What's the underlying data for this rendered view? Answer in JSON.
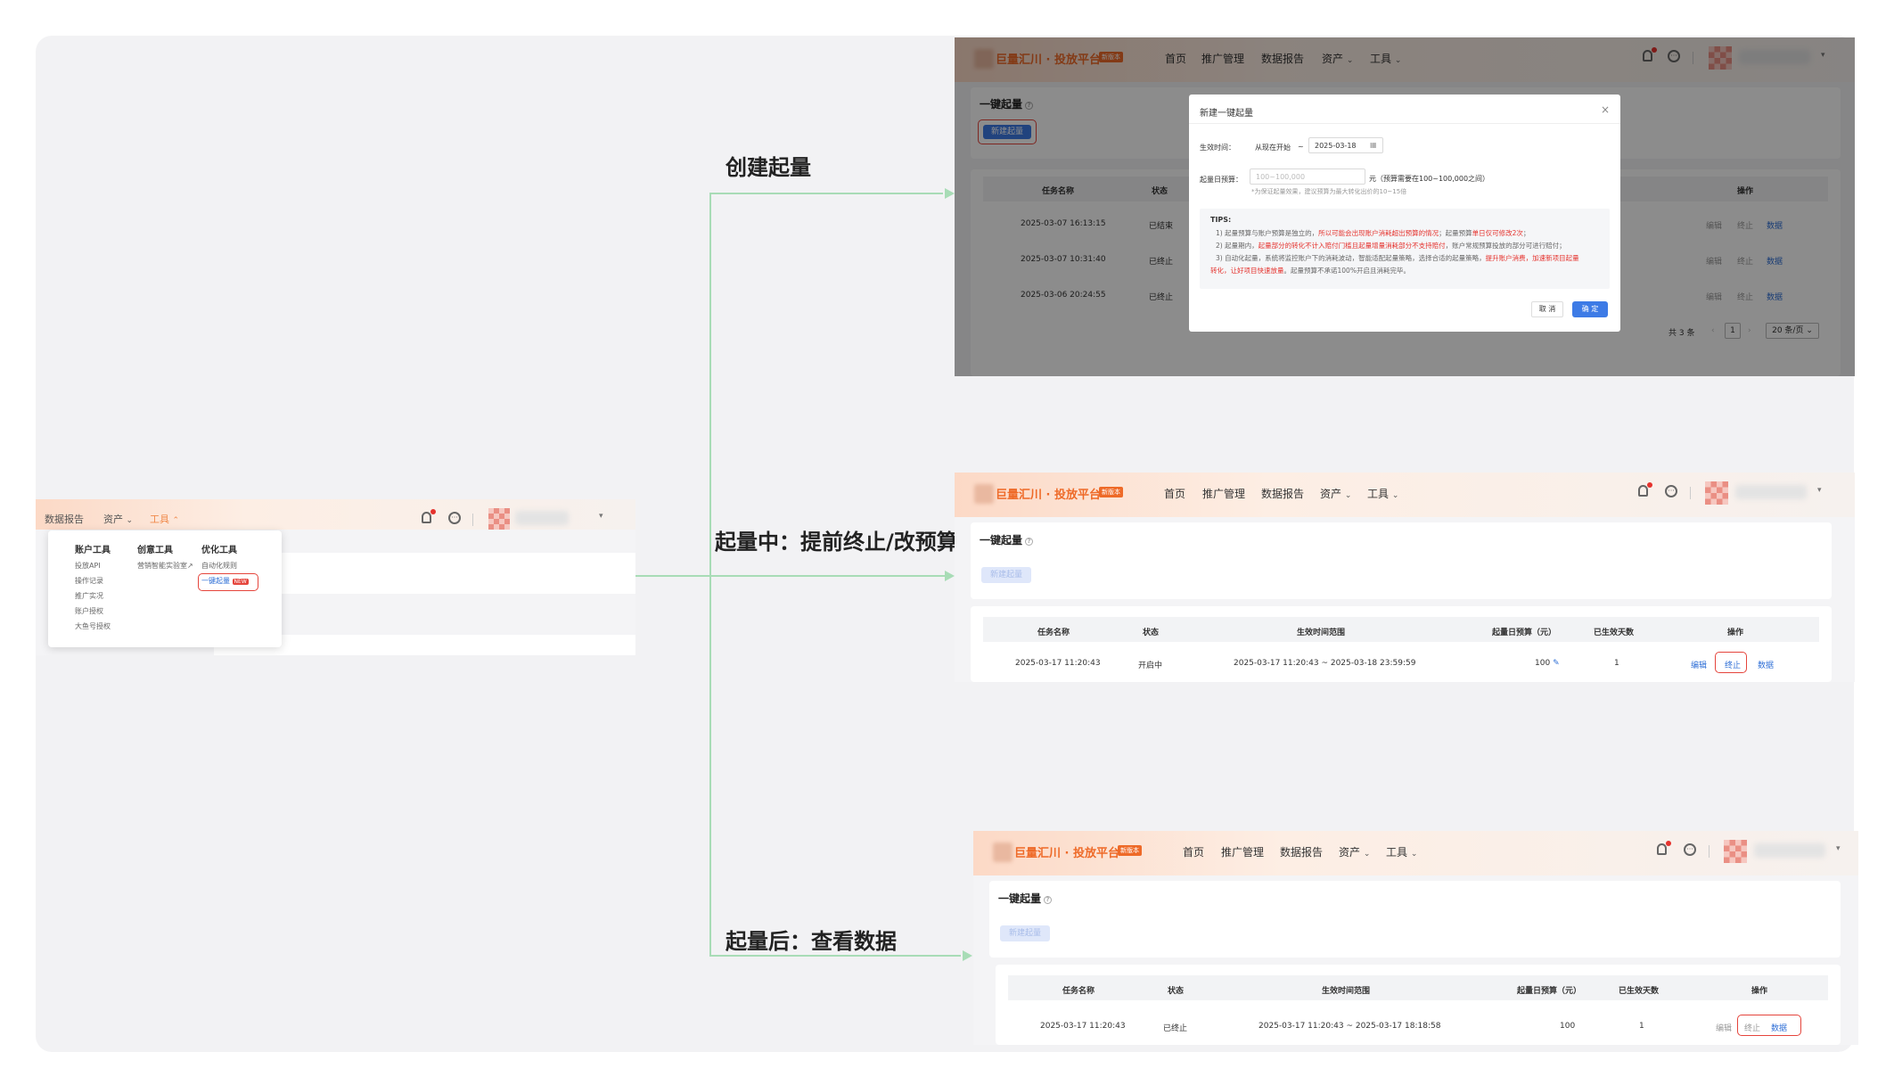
{
  "steps": {
    "create": "创建起量",
    "during": "起量中：提前终止/改预算",
    "after": "起量后：查看数据"
  },
  "header": {
    "brand": "巨量汇川 · 投放平台",
    "brand_badge": "新版本",
    "nav": [
      "首页",
      "推广管理",
      "数据报告",
      "资产",
      "工具"
    ]
  },
  "menu_panel": {
    "nav": [
      "数据报告",
      "资产",
      "工具"
    ],
    "columns": [
      {
        "title": "账户工具",
        "items": [
          "投放API",
          "操作记录",
          "推广实况",
          "账户授权",
          "大鱼号授权"
        ]
      },
      {
        "title": "创意工具",
        "items": [
          "营销智能实验室"
        ]
      },
      {
        "title": "优化工具",
        "items": [
          "自动化规则",
          "一键起量"
        ]
      }
    ],
    "new_badge": "NEW"
  },
  "page": {
    "title": "一键起量",
    "new_button": "新建起量"
  },
  "table": {
    "headers": [
      "任务名称",
      "状态",
      "生效时间范围",
      "起量日预算（元）",
      "已生效天数",
      "操作"
    ],
    "actions": [
      "编辑",
      "终止",
      "数据"
    ]
  },
  "panel_create": {
    "rows": [
      {
        "name": "2025-03-07 16:13:15",
        "status": "已结束"
      },
      {
        "name": "2025-03-07 10:31:40",
        "status": "已终止"
      },
      {
        "name": "2025-03-06 20:24:55",
        "status": "已终止"
      }
    ],
    "pagination": {
      "total": "共 3 条",
      "page": "1",
      "page_size": "20 条/页"
    }
  },
  "modal": {
    "title": "新建一键起量",
    "time_label": "生效时间：",
    "time_start": "从现在开始",
    "time_sep": "~",
    "time_end": "2025-03-18",
    "budget_label": "起量日预算：",
    "budget_placeholder": "100~100,000",
    "budget_unit": "元（预算需要在100~100,000之间）",
    "budget_hint": "*为保证起量效果，建议预算为最大转化出价的10~15倍",
    "tips_title": "TIPS:",
    "tips": [
      {
        "num": "1)",
        "a": "起量预算与账户预算是独立的，",
        "red": "所以可能会出现账户消耗超出预算的情况",
        "b": "；起量预算",
        "red2": "单日仅可修改2次",
        "c": "；"
      },
      {
        "num": "2)",
        "a": "起量期内，",
        "red": "起量部分的转化不计入赔付门槛且起量增量消耗部分不支持赔付",
        "b": "，账户常规预算投放的部分可进行赔付；",
        "red2": "",
        "c": ""
      },
      {
        "num": "3)",
        "a": "自动化起量，系统将监控账户下的消耗波动，智能适配起量策略，选择合适的起量策略，",
        "red": "提升账户消费，加速新项目起量",
        "b": "",
        "red2": "",
        "c": ""
      }
    ],
    "tips_tail_red": "转化，让好项目快速放量",
    "tips_tail": "。起量预算不承诺100%开启且消耗完毕。",
    "cancel": "取 消",
    "confirm": "确 定"
  },
  "panel_during": {
    "row": {
      "name": "2025-03-17 11:20:43",
      "status": "开启中",
      "range": "2025-03-17 11:20:43 ~ 2025-03-18 23:59:59",
      "budget": "100",
      "days": "1"
    }
  },
  "panel_after": {
    "row": {
      "name": "2025-03-17 11:20:43",
      "status": "已终止",
      "range": "2025-03-17 11:20:43 ~ 2025-03-17 18:18:58",
      "budget": "100",
      "days": "1"
    }
  },
  "colors": {
    "brand": "#ee6a28",
    "primary": "#3d7be6",
    "highlight": "#e5453c",
    "connector": "#a8dcb6"
  }
}
